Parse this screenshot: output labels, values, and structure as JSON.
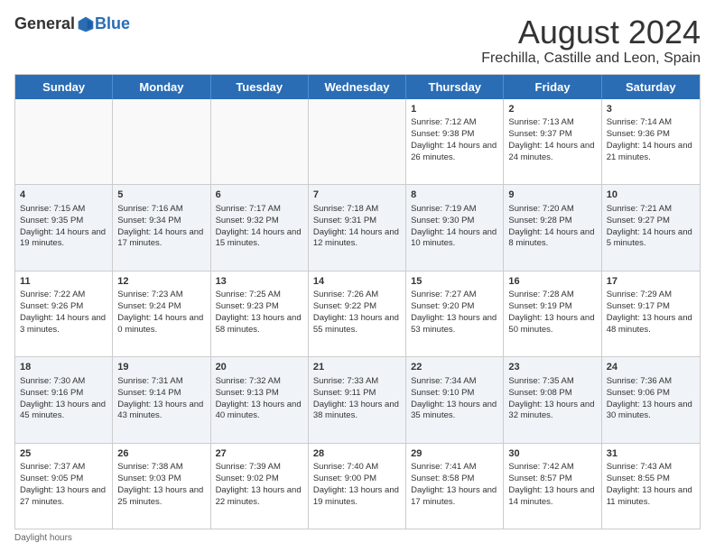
{
  "logo": {
    "general": "General",
    "blue": "Blue"
  },
  "title": "August 2024",
  "subtitle": "Frechilla, Castille and Leon, Spain",
  "header_days": [
    "Sunday",
    "Monday",
    "Tuesday",
    "Wednesday",
    "Thursday",
    "Friday",
    "Saturday"
  ],
  "footer": "Daylight hours",
  "weeks": [
    [
      {
        "day": "",
        "info": ""
      },
      {
        "day": "",
        "info": ""
      },
      {
        "day": "",
        "info": ""
      },
      {
        "day": "",
        "info": ""
      },
      {
        "day": "1",
        "info": "Sunrise: 7:12 AM\nSunset: 9:38 PM\nDaylight: 14 hours and 26 minutes."
      },
      {
        "day": "2",
        "info": "Sunrise: 7:13 AM\nSunset: 9:37 PM\nDaylight: 14 hours and 24 minutes."
      },
      {
        "day": "3",
        "info": "Sunrise: 7:14 AM\nSunset: 9:36 PM\nDaylight: 14 hours and 21 minutes."
      }
    ],
    [
      {
        "day": "4",
        "info": "Sunrise: 7:15 AM\nSunset: 9:35 PM\nDaylight: 14 hours and 19 minutes."
      },
      {
        "day": "5",
        "info": "Sunrise: 7:16 AM\nSunset: 9:34 PM\nDaylight: 14 hours and 17 minutes."
      },
      {
        "day": "6",
        "info": "Sunrise: 7:17 AM\nSunset: 9:32 PM\nDaylight: 14 hours and 15 minutes."
      },
      {
        "day": "7",
        "info": "Sunrise: 7:18 AM\nSunset: 9:31 PM\nDaylight: 14 hours and 12 minutes."
      },
      {
        "day": "8",
        "info": "Sunrise: 7:19 AM\nSunset: 9:30 PM\nDaylight: 14 hours and 10 minutes."
      },
      {
        "day": "9",
        "info": "Sunrise: 7:20 AM\nSunset: 9:28 PM\nDaylight: 14 hours and 8 minutes."
      },
      {
        "day": "10",
        "info": "Sunrise: 7:21 AM\nSunset: 9:27 PM\nDaylight: 14 hours and 5 minutes."
      }
    ],
    [
      {
        "day": "11",
        "info": "Sunrise: 7:22 AM\nSunset: 9:26 PM\nDaylight: 14 hours and 3 minutes."
      },
      {
        "day": "12",
        "info": "Sunrise: 7:23 AM\nSunset: 9:24 PM\nDaylight: 14 hours and 0 minutes."
      },
      {
        "day": "13",
        "info": "Sunrise: 7:25 AM\nSunset: 9:23 PM\nDaylight: 13 hours and 58 minutes."
      },
      {
        "day": "14",
        "info": "Sunrise: 7:26 AM\nSunset: 9:22 PM\nDaylight: 13 hours and 55 minutes."
      },
      {
        "day": "15",
        "info": "Sunrise: 7:27 AM\nSunset: 9:20 PM\nDaylight: 13 hours and 53 minutes."
      },
      {
        "day": "16",
        "info": "Sunrise: 7:28 AM\nSunset: 9:19 PM\nDaylight: 13 hours and 50 minutes."
      },
      {
        "day": "17",
        "info": "Sunrise: 7:29 AM\nSunset: 9:17 PM\nDaylight: 13 hours and 48 minutes."
      }
    ],
    [
      {
        "day": "18",
        "info": "Sunrise: 7:30 AM\nSunset: 9:16 PM\nDaylight: 13 hours and 45 minutes."
      },
      {
        "day": "19",
        "info": "Sunrise: 7:31 AM\nSunset: 9:14 PM\nDaylight: 13 hours and 43 minutes."
      },
      {
        "day": "20",
        "info": "Sunrise: 7:32 AM\nSunset: 9:13 PM\nDaylight: 13 hours and 40 minutes."
      },
      {
        "day": "21",
        "info": "Sunrise: 7:33 AM\nSunset: 9:11 PM\nDaylight: 13 hours and 38 minutes."
      },
      {
        "day": "22",
        "info": "Sunrise: 7:34 AM\nSunset: 9:10 PM\nDaylight: 13 hours and 35 minutes."
      },
      {
        "day": "23",
        "info": "Sunrise: 7:35 AM\nSunset: 9:08 PM\nDaylight: 13 hours and 32 minutes."
      },
      {
        "day": "24",
        "info": "Sunrise: 7:36 AM\nSunset: 9:06 PM\nDaylight: 13 hours and 30 minutes."
      }
    ],
    [
      {
        "day": "25",
        "info": "Sunrise: 7:37 AM\nSunset: 9:05 PM\nDaylight: 13 hours and 27 minutes."
      },
      {
        "day": "26",
        "info": "Sunrise: 7:38 AM\nSunset: 9:03 PM\nDaylight: 13 hours and 25 minutes."
      },
      {
        "day": "27",
        "info": "Sunrise: 7:39 AM\nSunset: 9:02 PM\nDaylight: 13 hours and 22 minutes."
      },
      {
        "day": "28",
        "info": "Sunrise: 7:40 AM\nSunset: 9:00 PM\nDaylight: 13 hours and 19 minutes."
      },
      {
        "day": "29",
        "info": "Sunrise: 7:41 AM\nSunset: 8:58 PM\nDaylight: 13 hours and 17 minutes."
      },
      {
        "day": "30",
        "info": "Sunrise: 7:42 AM\nSunset: 8:57 PM\nDaylight: 13 hours and 14 minutes."
      },
      {
        "day": "31",
        "info": "Sunrise: 7:43 AM\nSunset: 8:55 PM\nDaylight: 13 hours and 11 minutes."
      }
    ]
  ]
}
